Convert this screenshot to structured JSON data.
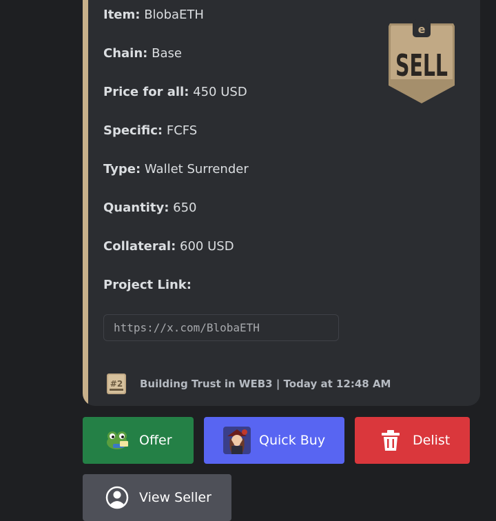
{
  "embed": {
    "fields": [
      {
        "key": "Item:",
        "value": "BlobaETH"
      },
      {
        "key": "Chain:",
        "value": "Base"
      },
      {
        "key": "Price for all:",
        "value": "450 USD"
      },
      {
        "key": "Specific:",
        "value": "FCFS"
      },
      {
        "key": "Type:",
        "value": "Wallet Surrender"
      },
      {
        "key": "Quantity:",
        "value": "650"
      },
      {
        "key": "Collateral:",
        "value": "600 USD"
      },
      {
        "key": "Project Link:",
        "value": ""
      }
    ],
    "project_link": "https://x.com/BlobaETH",
    "thumbnail_text": "SELL",
    "footer": {
      "icon_text": "#2",
      "text": "Building Trust in WEB3 | Today at 12:48 AM"
    },
    "accent_color": "#c8b08a"
  },
  "buttons": {
    "offer": {
      "label": "Offer",
      "icon": "frog-pepe-icon",
      "color": "#248046"
    },
    "quick_buy": {
      "label": "Quick Buy",
      "icon": "pirate-avatar-icon",
      "color": "#5865f2"
    },
    "delist": {
      "label": "Delist",
      "icon": "trash-icon",
      "color": "#da373c"
    },
    "view_seller": {
      "label": "View Seller",
      "icon": "user-circle-icon",
      "color": "#4e5058"
    }
  }
}
